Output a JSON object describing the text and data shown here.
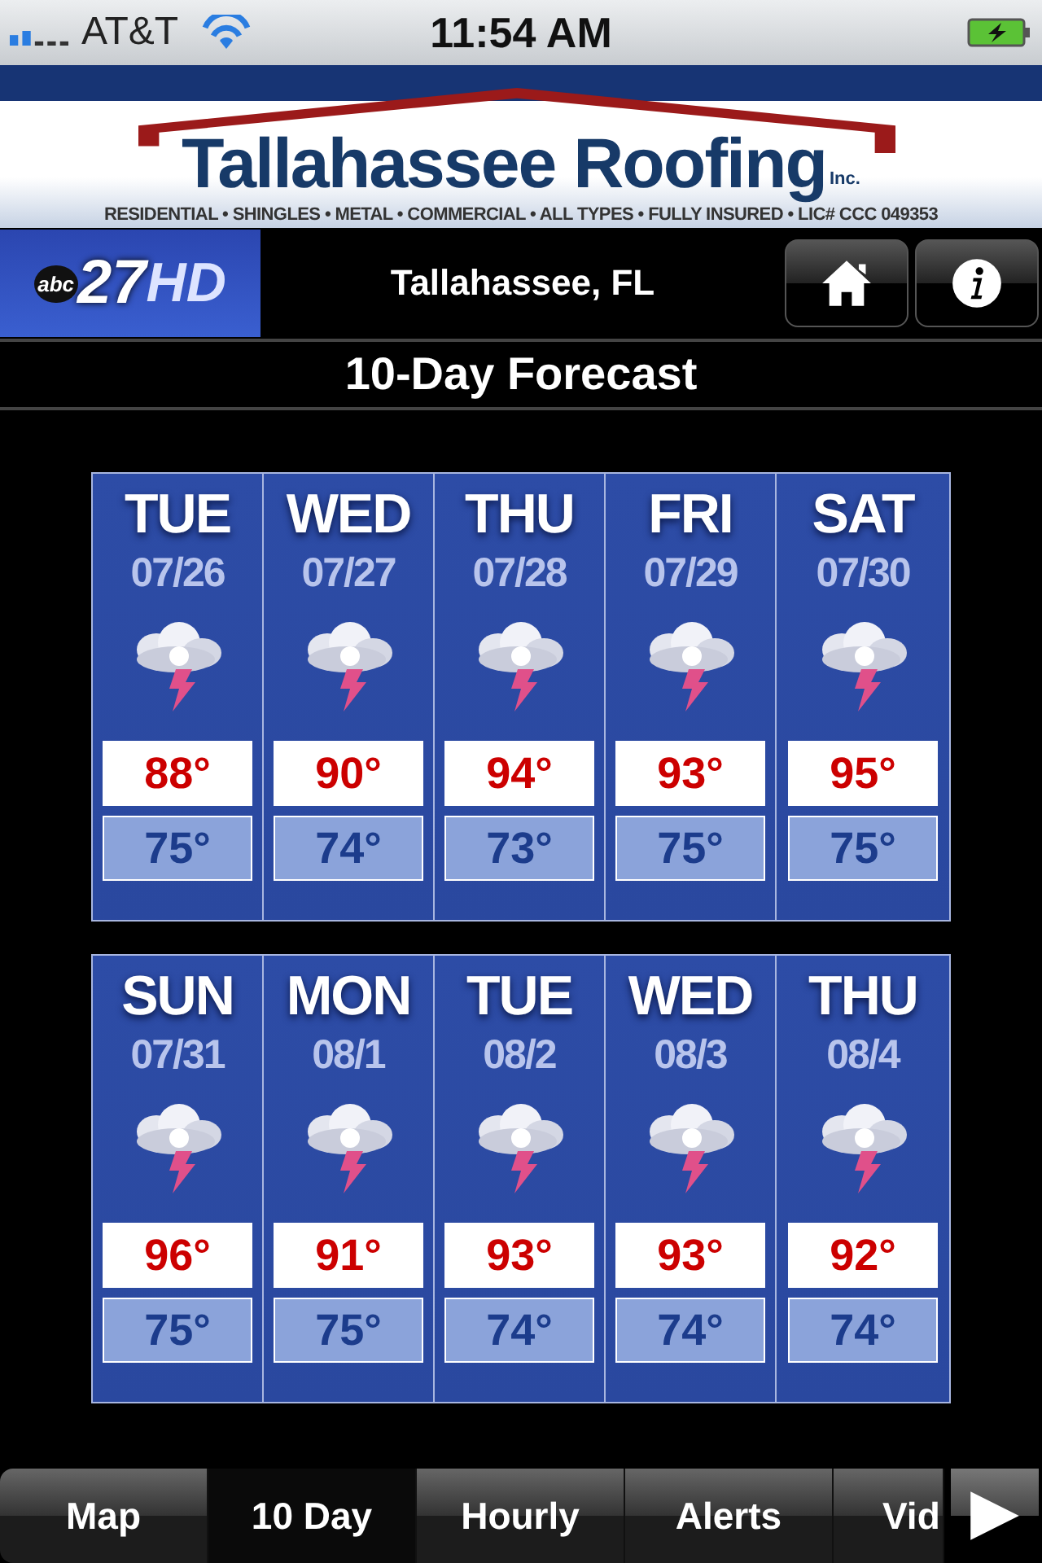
{
  "status_bar": {
    "carrier": "AT&T",
    "time": "11:54 AM"
  },
  "banner": {
    "company": "Tallahassee Roofing",
    "suffix": "Inc.",
    "tagline": "RESIDENTIAL • SHINGLES • METAL • COMMERCIAL • ALL TYPES • FULLY INSURED • LIC# CCC 049353"
  },
  "header": {
    "logo_small": "abc",
    "logo_number": "27",
    "logo_suffix": "HD",
    "location": "Tallahassee, FL"
  },
  "title": "10-Day Forecast",
  "forecast_rows": [
    [
      {
        "day": "TUE",
        "date": "07/26",
        "high": "88°",
        "low": "75°"
      },
      {
        "day": "WED",
        "date": "07/27",
        "high": "90°",
        "low": "74°"
      },
      {
        "day": "THU",
        "date": "07/28",
        "high": "94°",
        "low": "73°"
      },
      {
        "day": "FRI",
        "date": "07/29",
        "high": "93°",
        "low": "75°"
      },
      {
        "day": "SAT",
        "date": "07/30",
        "high": "95°",
        "low": "75°"
      }
    ],
    [
      {
        "day": "SUN",
        "date": "07/31",
        "high": "96°",
        "low": "75°"
      },
      {
        "day": "MON",
        "date": "08/1",
        "high": "91°",
        "low": "75°"
      },
      {
        "day": "TUE",
        "date": "08/2",
        "high": "93°",
        "low": "74°"
      },
      {
        "day": "WED",
        "date": "08/3",
        "high": "93°",
        "low": "74°"
      },
      {
        "day": "THU",
        "date": "08/4",
        "high": "92°",
        "low": "74°"
      }
    ]
  ],
  "tabs": [
    {
      "label": "Map",
      "selected": false
    },
    {
      "label": "10 Day",
      "selected": true
    },
    {
      "label": "Hourly",
      "selected": false
    },
    {
      "label": "Alerts",
      "selected": false
    },
    {
      "label": "Vid",
      "selected": false
    }
  ]
}
